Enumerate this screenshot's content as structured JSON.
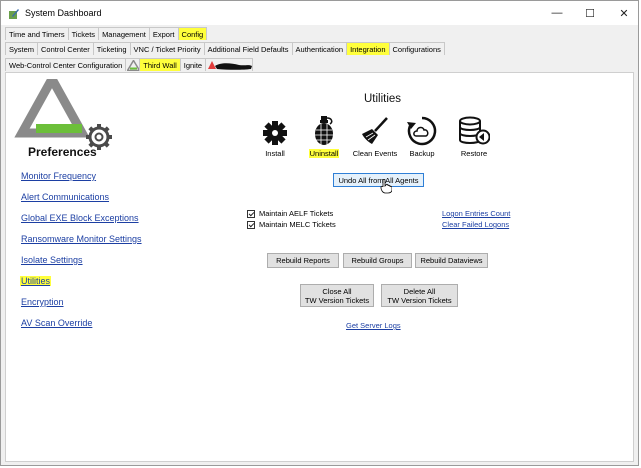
{
  "window": {
    "title": "System Dashboard",
    "controls": {
      "minimize": "—",
      "maximize": "☐",
      "close": "✕"
    }
  },
  "tabs_row1": [
    {
      "label": "Time and Timers",
      "highlighted": false,
      "selected": false
    },
    {
      "label": "Tickets",
      "highlighted": false,
      "selected": false
    },
    {
      "label": "Management",
      "highlighted": false,
      "selected": false
    },
    {
      "label": "Export",
      "highlighted": false,
      "selected": false
    },
    {
      "label": "Config",
      "highlighted": true,
      "selected": true
    }
  ],
  "tabs_row2": [
    {
      "label": "System",
      "highlighted": false,
      "selected": false
    },
    {
      "label": "Control Center",
      "highlighted": false,
      "selected": false
    },
    {
      "label": "Ticketing",
      "highlighted": false,
      "selected": false
    },
    {
      "label": "VNC / Ticket Priority",
      "highlighted": false,
      "selected": false
    },
    {
      "label": "Additional Field Defaults",
      "highlighted": false,
      "selected": false
    },
    {
      "label": "Authentication",
      "highlighted": false,
      "selected": false
    },
    {
      "label": "Integration",
      "highlighted": true,
      "selected": true
    },
    {
      "label": "Configurations",
      "highlighted": false,
      "selected": false
    }
  ],
  "tabs_row3": [
    {
      "label": "Web-Control Center Configuration",
      "icon": "",
      "highlighted": false,
      "selected": false
    },
    {
      "label": "Third Wall",
      "icon": "third-wall-logo-icon",
      "highlighted": true,
      "selected": true
    },
    {
      "label": "Ignite",
      "icon": "",
      "highlighted": false,
      "selected": false
    },
    {
      "label": "",
      "icon": "redacted-warning-icon",
      "highlighted": false,
      "selected": false
    }
  ],
  "preferences": {
    "label": "Preferences",
    "logo_icon": "third-wall-gear-logo-icon"
  },
  "nav_links": [
    {
      "label": "Monitor Frequency",
      "highlighted": false
    },
    {
      "label": "Alert Communications",
      "highlighted": false
    },
    {
      "label": "Global EXE Block Exceptions",
      "highlighted": false
    },
    {
      "label": "Ransomware Monitor Settings",
      "highlighted": false
    },
    {
      "label": "Isolate Settings",
      "highlighted": false
    },
    {
      "label": "Utilities",
      "highlighted": true
    },
    {
      "label": "Encryption",
      "highlighted": false
    },
    {
      "label": "AV Scan Override",
      "highlighted": false
    }
  ],
  "utilities": {
    "heading": "Utilities",
    "tools": [
      {
        "label": "Install",
        "icon": "gear-install-icon",
        "highlighted": false
      },
      {
        "label": "Uninstall",
        "icon": "grenade-icon",
        "highlighted": true
      },
      {
        "label": "Clean Events",
        "icon": "broom-icon",
        "highlighted": false
      },
      {
        "label": "Backup",
        "icon": "cloud-backup-icon",
        "highlighted": false
      },
      {
        "label": "Restore",
        "icon": "database-restore-icon",
        "highlighted": false
      }
    ],
    "undo_button": "Undo All from All Agents",
    "checkboxes": [
      {
        "label": "Maintain AELF Tickets",
        "checked": true
      },
      {
        "label": "Maintain MELC Tickets",
        "checked": true
      }
    ],
    "right_links": [
      "Logon Entries Count",
      "Clear Failed Logons"
    ],
    "rebuild_buttons": [
      "Rebuild Reports",
      "Rebuild Groups",
      "Rebuild Dataviews"
    ],
    "close_all_button": "Close All\nTW Version Tickets",
    "delete_all_button": "Delete All\nTW Version Tickets",
    "server_logs_link": "Get Server Logs"
  },
  "colors": {
    "highlight": "#ffff3c",
    "link": "#1c3fa3",
    "logo_gray": "#8a8a8a",
    "logo_green": "#6cbf3a"
  }
}
